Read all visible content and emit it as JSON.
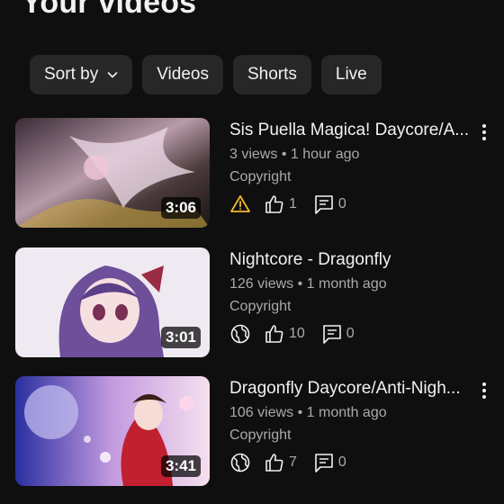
{
  "header": {
    "title": "Your videos"
  },
  "filters": [
    {
      "label": "Sort by",
      "has_dropdown": true
    },
    {
      "label": "Videos"
    },
    {
      "label": "Shorts"
    },
    {
      "label": "Live"
    }
  ],
  "videos": [
    {
      "title": "Sis Puella Magica! Daycore/A...",
      "views": "3 views",
      "age": "1 hour ago",
      "separator": "•",
      "visibility": "Copyright",
      "duration": "3:06",
      "status_icon": "warning-icon",
      "likes": "1",
      "comments": "0",
      "status_color": "#f2b82e"
    },
    {
      "title": "Nightcore - Dragonfly",
      "views": "126 views",
      "age": "1 month ago",
      "separator": "•",
      "visibility": "Copyright",
      "duration": "3:01",
      "status_icon": "globe-icon",
      "likes": "10",
      "comments": "0"
    },
    {
      "title": "Dragonfly Daycore/Anti-Nigh...",
      "views": "106 views",
      "age": "1 month ago",
      "separator": "•",
      "visibility": "Copyright",
      "duration": "3:41",
      "status_icon": "globe-icon",
      "likes": "7",
      "comments": "0"
    }
  ],
  "colors": {
    "background": "#0f0f0f",
    "chip": "#272727",
    "text": "#f1f1f1",
    "secondary": "#aaaaaa"
  }
}
